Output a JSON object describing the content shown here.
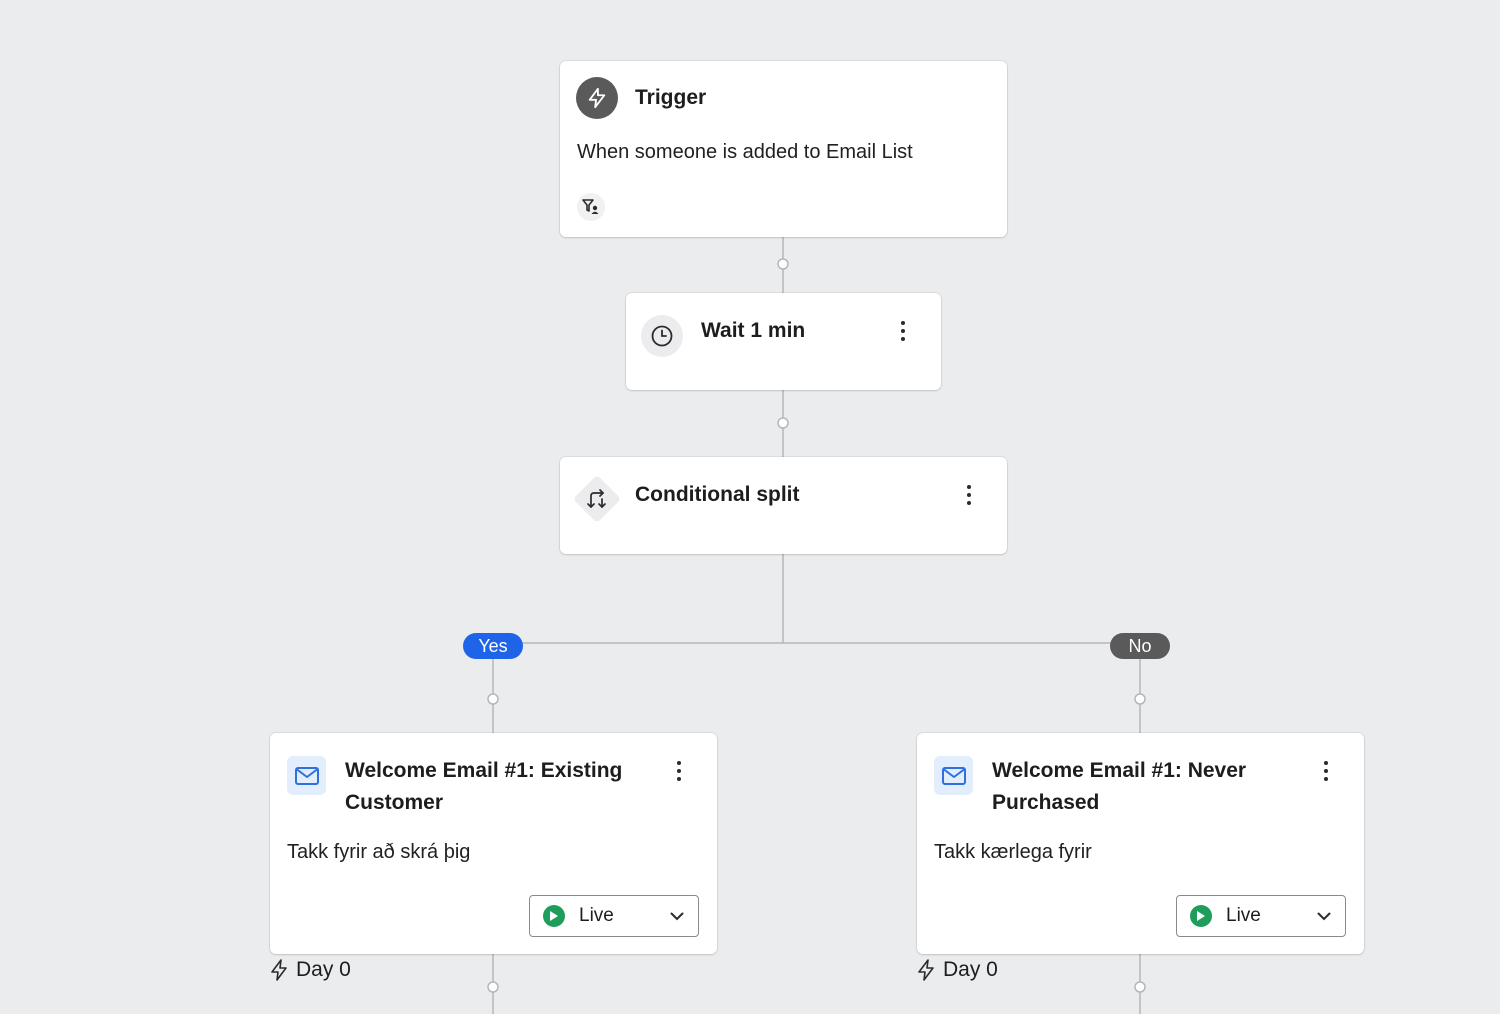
{
  "trigger": {
    "title": "Trigger",
    "description": "When someone is added to Email List",
    "icon": "lightning-icon",
    "filter_icon": "filter-person-icon"
  },
  "wait": {
    "title": "Wait 1 min",
    "icon": "clock-icon"
  },
  "split": {
    "title": "Conditional split",
    "icon": "split-arrows-icon",
    "yes_label": "Yes",
    "no_label": "No"
  },
  "emails": [
    {
      "title": "Welcome Email #1: Existing Customer",
      "title_line1": "Welcome Email #1: Existing",
      "title_line2": "Customer",
      "subject": "Takk fyrir að skrá þig",
      "status": "Live",
      "day": "Day 0"
    },
    {
      "title": "Welcome Email #1: Never Purchased",
      "title_line1": "Welcome Email #1: Never",
      "title_line2": "Purchased",
      "subject": "Takk kærlega fyrir",
      "status": "Live",
      "day": "Day 0"
    }
  ],
  "colors": {
    "background": "#ebecee",
    "yes_pill": "#1f63e9",
    "no_pill": "#5a5a5a",
    "live": "#1f9e5b",
    "email_icon_bg": "#e3eefc",
    "email_icon": "#2f6fe0"
  }
}
